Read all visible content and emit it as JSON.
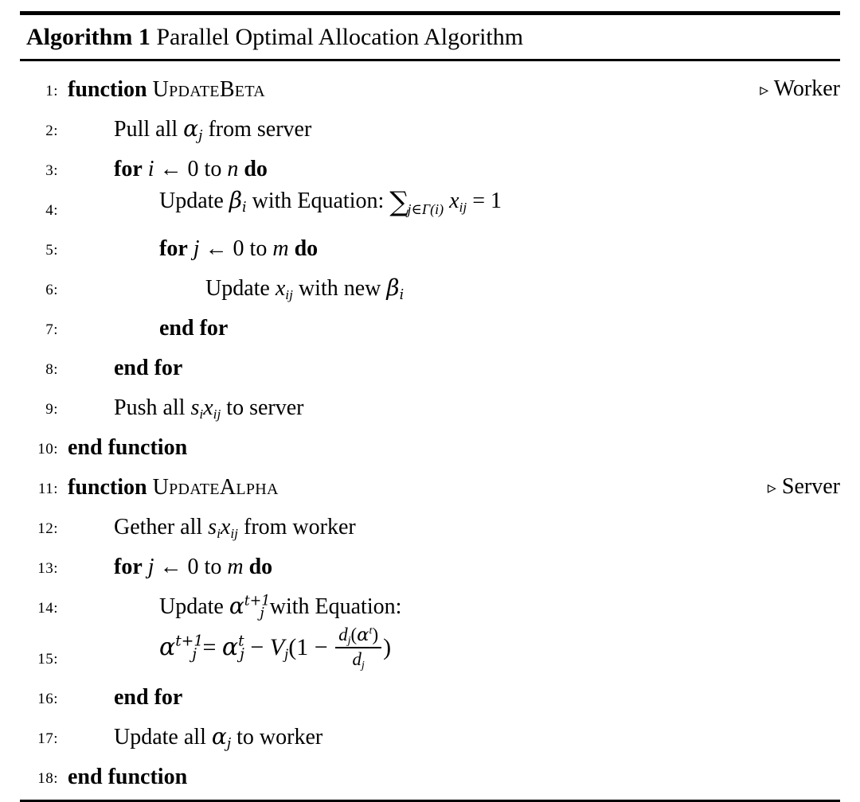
{
  "algorithm": {
    "caption_label": "Algorithm 1",
    "caption_title": "Parallel Optimal Allocation Algorithm",
    "comment_marker": "▹",
    "lines": [
      {
        "no": "1:",
        "comment": "Worker"
      },
      {
        "no": "2:",
        "comment": ""
      },
      {
        "no": "3:",
        "comment": ""
      },
      {
        "no": "4:",
        "comment": ""
      },
      {
        "no": "5:",
        "comment": ""
      },
      {
        "no": "6:",
        "comment": ""
      },
      {
        "no": "7:",
        "comment": ""
      },
      {
        "no": "8:",
        "comment": ""
      },
      {
        "no": "9:",
        "comment": ""
      },
      {
        "no": "10:",
        "comment": ""
      },
      {
        "no": "11:",
        "comment": "Server"
      },
      {
        "no": "12:",
        "comment": ""
      },
      {
        "no": "13:",
        "comment": ""
      },
      {
        "no": "14:",
        "comment": ""
      },
      {
        "no": "15:",
        "comment": ""
      },
      {
        "no": "16:",
        "comment": ""
      },
      {
        "no": "17:",
        "comment": ""
      },
      {
        "no": "18:",
        "comment": ""
      }
    ],
    "text": {
      "kw_function": "function",
      "kw_end_function": "end function",
      "kw_for": "for",
      "kw_do": "do",
      "kw_end_for": "end for",
      "name_update_beta": "UpdateBeta",
      "name_update_alpha": "UpdateAlpha",
      "l2_pull": "Pull all",
      "l2_from_server": "from server",
      "l3_var": "i",
      "l3_from": "0",
      "l3_to": "to",
      "l3_bound": "n",
      "l4_update": "Update",
      "l4_with_equation": "with Equation:",
      "l4_eq_sum": "∑",
      "l4_eq_sub": "j∈Γ(i)",
      "l4_eq_rhs": "= 1",
      "l5_var": "j",
      "l5_from": "0",
      "l5_to": "to",
      "l5_bound": "m",
      "l6_update": "Update",
      "l6_with_new": "with new",
      "l9_push": "Push all",
      "l9_to_server": "to server",
      "l12_gether": "Gether all",
      "l12_from_worker": "from worker",
      "l13_var": "j",
      "l13_from": "0",
      "l13_to": "to",
      "l13_bound": "m",
      "l14_update": "Update",
      "l14_with_equation": "with Equation:",
      "l15_eq_equals": "=",
      "l15_eq_minus": "−",
      "l15_eq_V": "V",
      "l15_eq_open": "(1",
      "l15_eq_minus2": "−",
      "l15_eq_close": ")",
      "l15_num": "d",
      "l15_den": "d",
      "l17_update_all": "Update all",
      "l17_to_worker": "to worker",
      "sym_alpha": "α",
      "sym_beta": "β",
      "sym_x": "x",
      "sym_s": "s",
      "sym_d": "d",
      "sym_arrow": "←",
      "sup_t": "t",
      "sup_t1": "t+1",
      "sub_i": "i",
      "sub_j": "j",
      "sub_ij": "ij"
    }
  }
}
